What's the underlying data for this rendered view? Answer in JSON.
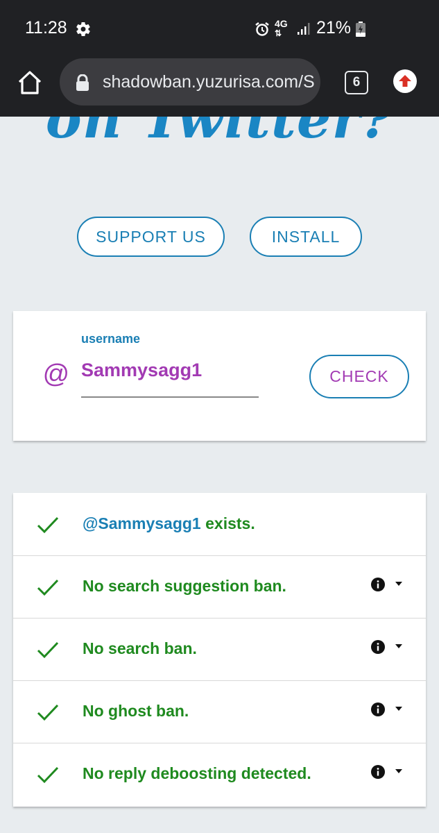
{
  "status_bar": {
    "time": "11:28",
    "battery_percent": "21%",
    "network": "4G"
  },
  "browser": {
    "url": "shadowban.yuzurisa.com/S",
    "tab_count": "6"
  },
  "page": {
    "hero_title": "on Twitter?",
    "support_label": "SUPPORT US",
    "install_label": "INSTALL",
    "username_label": "username",
    "at_symbol": "@",
    "username_value": "Sammysagg1",
    "check_label": "CHECK",
    "results": [
      {
        "prefix": "@Sammysagg1",
        "text": " exists.",
        "has_info": false
      },
      {
        "prefix": "",
        "text": "No search suggestion ban.",
        "has_info": true
      },
      {
        "prefix": "",
        "text": "No search ban.",
        "has_info": true
      },
      {
        "prefix": "",
        "text": "No ghost ban.",
        "has_info": true
      },
      {
        "prefix": "",
        "text": "No reply deboosting detected.",
        "has_info": true
      }
    ]
  },
  "colors": {
    "accent": "#1a7fb4",
    "username": "#a23ab3",
    "success": "#1f8a1f"
  }
}
